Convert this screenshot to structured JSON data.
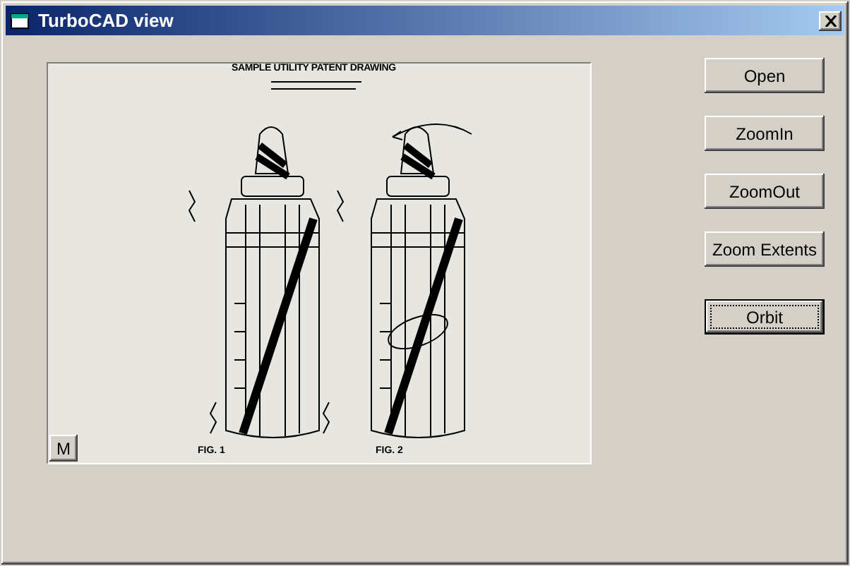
{
  "window": {
    "title": "TurboCAD view"
  },
  "viewport": {
    "drawing_title": "SAMPLE UTILITY PATENT DRAWING",
    "figures": [
      "FIG. 1",
      "FIG. 2"
    ],
    "corner_button": "M"
  },
  "buttons": [
    {
      "label": "Open",
      "focused": false
    },
    {
      "label": "ZoomIn",
      "focused": false
    },
    {
      "label": "ZoomOut",
      "focused": false
    },
    {
      "label": "Zoom Extents",
      "focused": false
    },
    {
      "label": "Orbit",
      "focused": true
    }
  ]
}
